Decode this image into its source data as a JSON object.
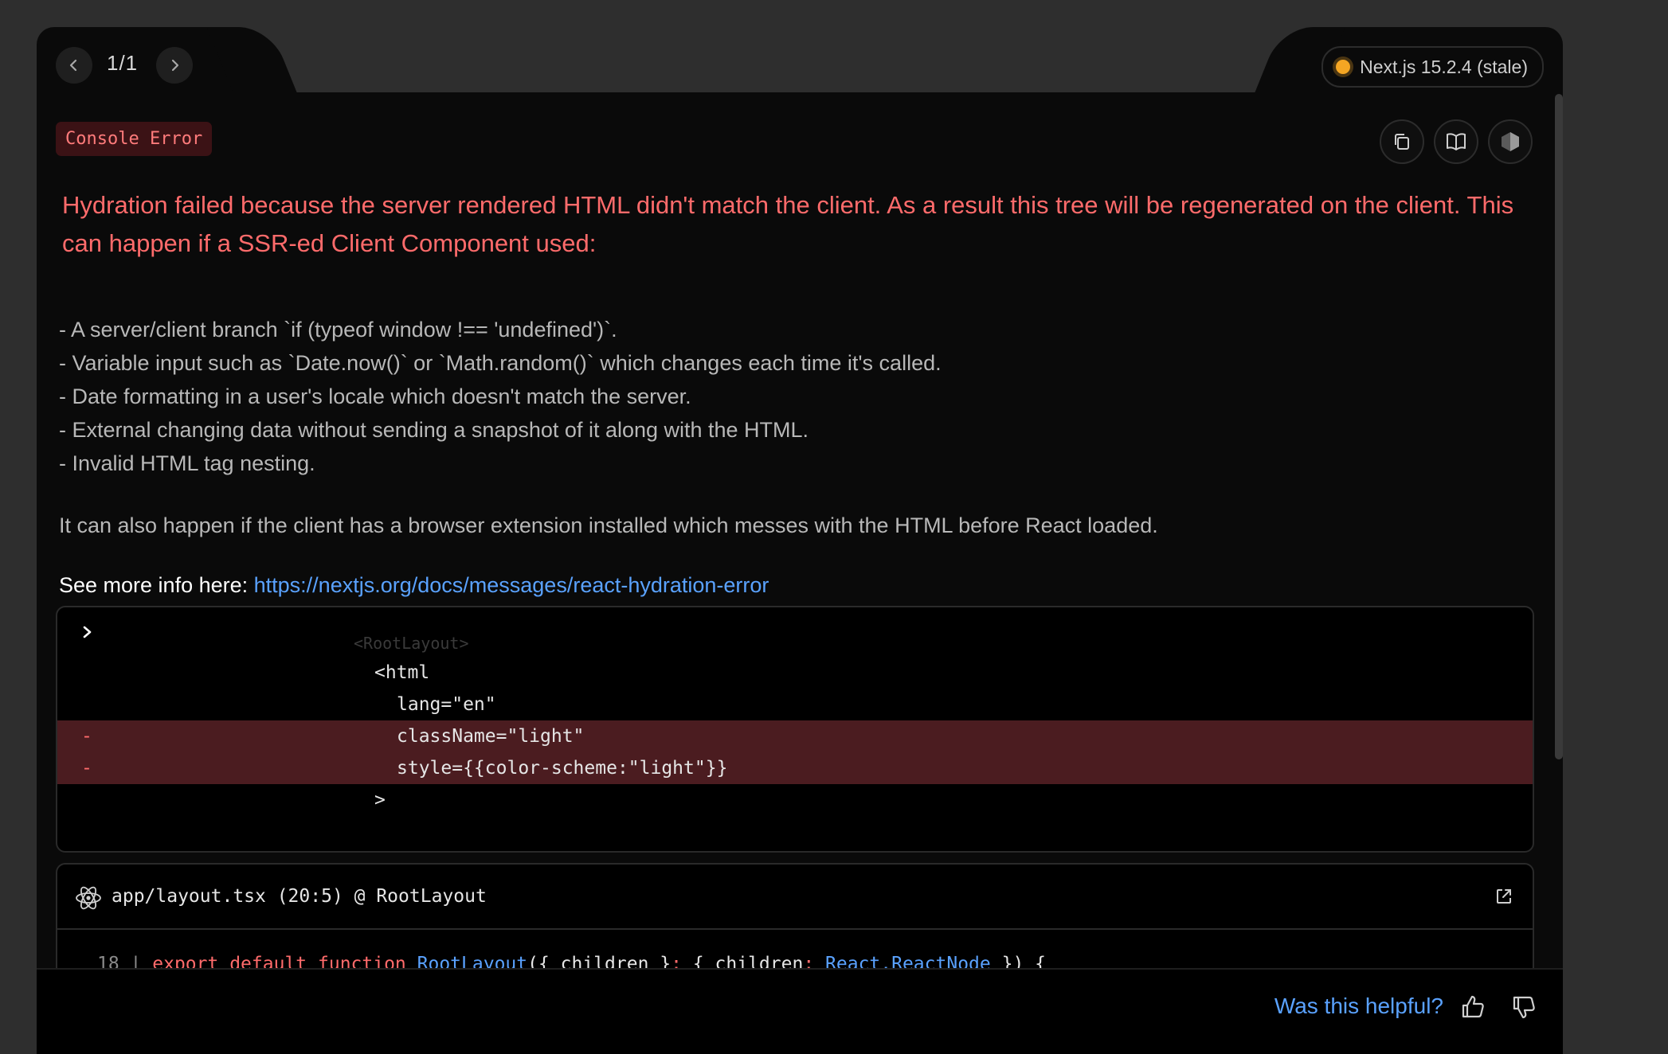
{
  "nav": {
    "counter": "1/1"
  },
  "version": {
    "label": "Next.js 15.2.4 (stale)",
    "status_color": "#f5a623"
  },
  "error": {
    "badge": "Console Error",
    "title": "Hydration failed because the server rendered HTML didn't match the client. As a result this tree will be regenerated on the client. This can happen if a SSR-ed Client Component used:",
    "bullets": [
      "- A server/client branch `if (typeof window !== 'undefined')`.",
      "- Variable input such as `Date.now()` or `Math.random()` which changes each time it's called.",
      "- Date formatting in a user's locale which doesn't match the server.",
      "- External changing data without sending a snapshot of it along with the HTML.",
      "- Invalid HTML tag nesting."
    ],
    "note": "It can also happen if the client has a browser extension installed which messes with the HTML before React loaded.",
    "more_prefix": "See more info here: ",
    "more_link": "https://nextjs.org/docs/messages/react-hydration-error"
  },
  "diff": {
    "faded_line": "<RootLayout>",
    "lines": [
      {
        "text": "<html",
        "marker": ""
      },
      {
        "text": "lang=\"en\"",
        "marker": ""
      },
      {
        "text": "className=\"light\"",
        "marker": "-"
      },
      {
        "text": "style={{color-scheme:\"light\"}}",
        "marker": "-"
      },
      {
        "text": ">",
        "marker": ""
      }
    ]
  },
  "source": {
    "path": "app/layout.tsx (20:5) @ RootLayout",
    "line_number": "18",
    "tokens": {
      "sep": " | ",
      "kw1": "export",
      "kw2": "default",
      "kw3": "function",
      "fn": "RootLayout",
      "p1": "({ children }",
      "c1": ":",
      "p2": " { children",
      "c2": ":",
      "ty": " React.ReactNode",
      "p3": " }) {"
    }
  },
  "footer": {
    "helpful": "Was this helpful?"
  }
}
